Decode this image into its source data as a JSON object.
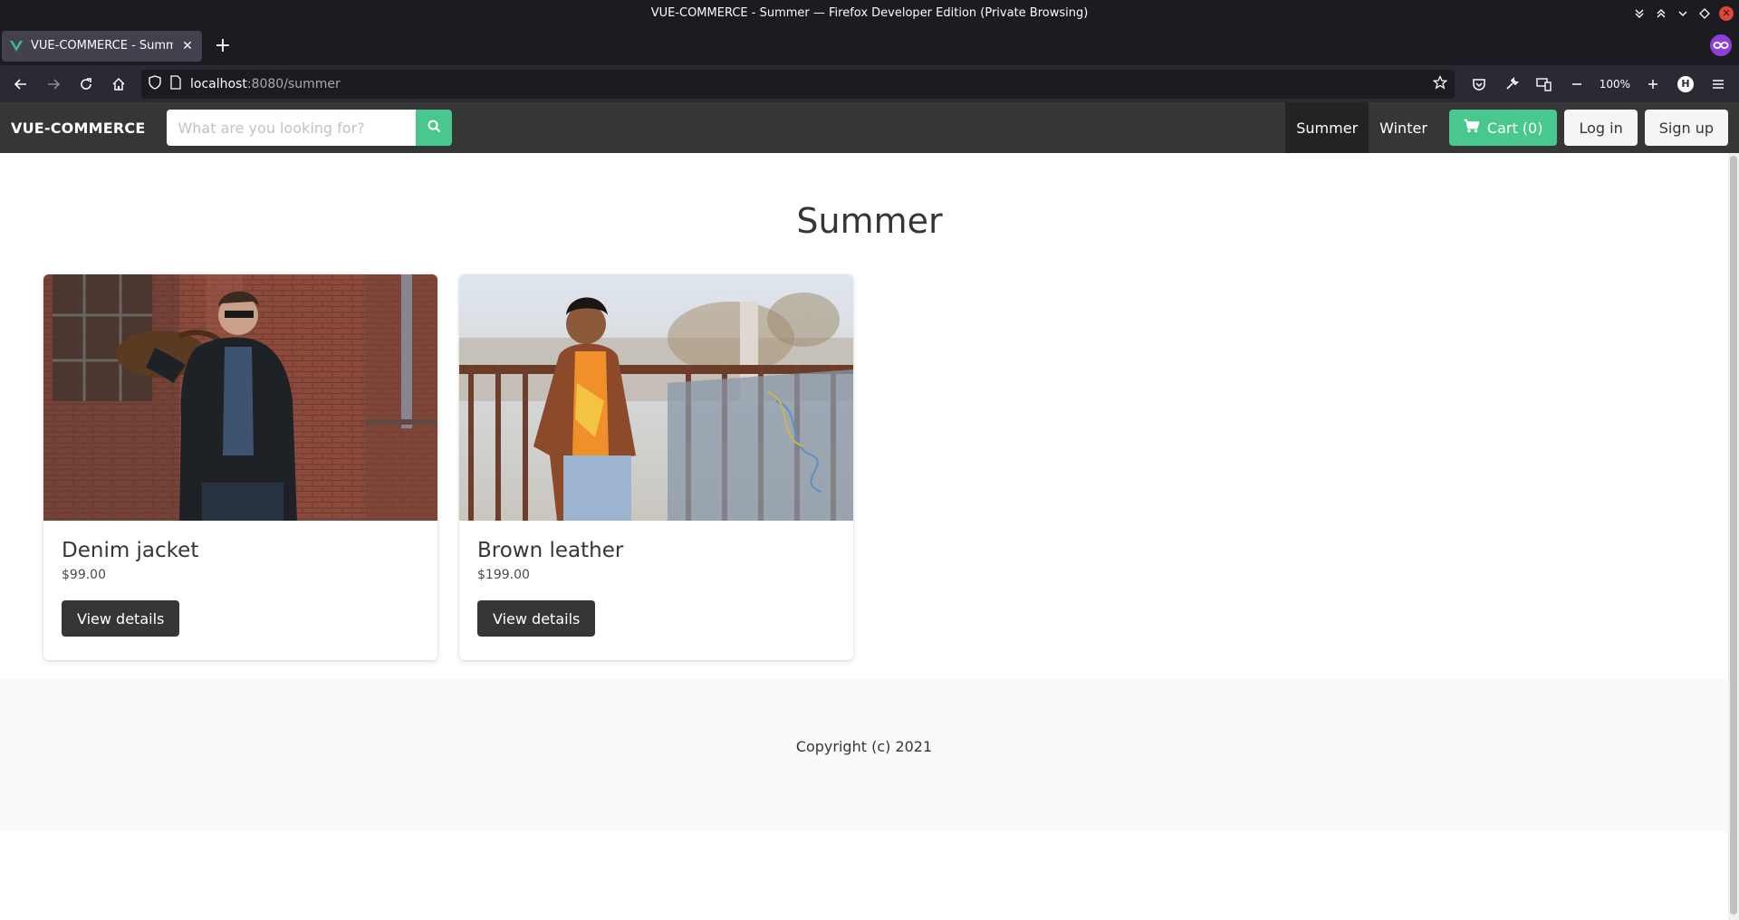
{
  "window": {
    "title": "VUE-COMMERCE - Summer — Firefox Developer Edition (Private Browsing)"
  },
  "tabs": [
    {
      "title": "VUE-COMMERCE - Summer",
      "favicon": "vue-logo-icon"
    }
  ],
  "address_bar": {
    "host": "localhost",
    "path": ":8080/summer",
    "zoom": "100%"
  },
  "profile": {
    "initial": "H"
  },
  "site": {
    "brand": "VUE-COMMERCE",
    "search_placeholder": "What are you looking for?",
    "nav": [
      {
        "label": "Summer",
        "active": true
      },
      {
        "label": "Winter",
        "active": false
      }
    ],
    "cart_label": "Cart (0)",
    "login_label": "Log in",
    "signup_label": "Sign up",
    "accent_color": "#48c78e",
    "header_color": "#363636"
  },
  "main": {
    "title": "Summer",
    "products": [
      {
        "name": "Denim jacket",
        "price": "$99.00",
        "button": "View details",
        "image": "photo-man-black-jacket-brick-wall"
      },
      {
        "name": "Brown leather",
        "price": "$199.00",
        "button": "View details",
        "image": "photo-man-brown-leather-jacket-railing"
      }
    ]
  },
  "footer": {
    "text": "Copyright (c) 2021"
  }
}
